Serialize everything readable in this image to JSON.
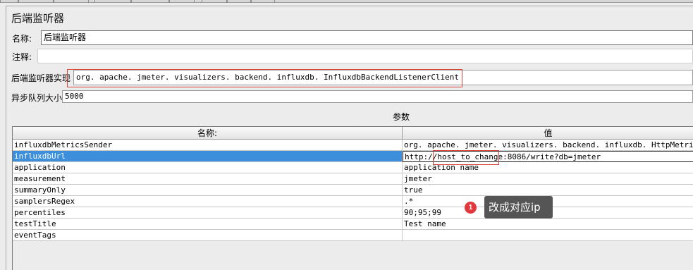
{
  "panel": {
    "title": "后端监听器"
  },
  "fields": {
    "name_label": "名称:",
    "name_value": "后端监听器",
    "comment_label": "注释:",
    "comment_value": "",
    "impl_label": "后端监听器实现",
    "impl_value": "org. apache. jmeter. visualizers. backend. influxdb. InfluxdbBackendListenerClient",
    "queue_label": "异步队列大小",
    "queue_value": "5000"
  },
  "params": {
    "caption": "参数",
    "headers": {
      "name": "名称:",
      "value": "值"
    },
    "rows": [
      {
        "name": "influxdbMetricsSender",
        "value": "org. apache. jmeter. visualizers. backend. influxdb. HttpMetricsSender"
      },
      {
        "name": "influxdbUrl",
        "value": "http://host_to_change:8086/write?db=jmeter"
      },
      {
        "name": "application",
        "value": "application name"
      },
      {
        "name": "measurement",
        "value": "jmeter"
      },
      {
        "name": "summaryOnly",
        "value": "true"
      },
      {
        "name": "samplersRegex",
        "value": ".*"
      },
      {
        "name": "percentiles",
        "value": "90;95;99"
      },
      {
        "name": "testTitle",
        "value": "Test name"
      },
      {
        "name": "eventTags",
        "value": ""
      }
    ],
    "selected_row": "influxdbUrl"
  },
  "annotation": {
    "number": "1",
    "text": "改成对应ip"
  },
  "colors": {
    "selection": "#3d8fdb",
    "highlight_box": "#d8443a",
    "callout_badge": "#e0383b",
    "callout_bg": "#555555"
  }
}
